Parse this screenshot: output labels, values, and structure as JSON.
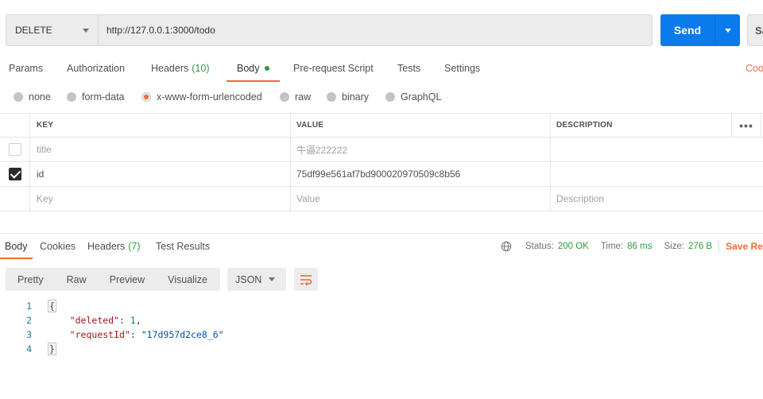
{
  "request": {
    "method": "DELETE",
    "url": "http://127.0.0.1:3000/todo",
    "send_label": "Send",
    "save_label": "Sa"
  },
  "request_tabs": [
    {
      "label": "Params"
    },
    {
      "label": "Authorization"
    },
    {
      "label": "Headers",
      "count": "(10)"
    },
    {
      "label": "Body",
      "active": true
    },
    {
      "label": "Pre-request Script"
    },
    {
      "label": "Tests"
    },
    {
      "label": "Settings"
    }
  ],
  "cookies_link": "Coo",
  "body_types": [
    {
      "label": "none"
    },
    {
      "label": "form-data"
    },
    {
      "label": "x-www-form-urlencoded",
      "selected": true
    },
    {
      "label": "raw"
    },
    {
      "label": "binary"
    },
    {
      "label": "GraphQL"
    }
  ],
  "params_table": {
    "headers": {
      "key": "KEY",
      "value": "VALUE",
      "description": "DESCRIPTION",
      "more": "•••"
    },
    "rows": [
      {
        "checked": false,
        "key": "title",
        "value": "牛逼222222",
        "description": ""
      },
      {
        "checked": true,
        "key": "id",
        "value": "75df99e561af7bd900020970509c8b56",
        "description": ""
      }
    ],
    "placeholder": {
      "key": "Key",
      "value": "Value",
      "description": "Description"
    }
  },
  "response_tabs": [
    {
      "label": "Body",
      "active": true
    },
    {
      "label": "Cookies"
    },
    {
      "label": "Headers",
      "count": "(7)"
    },
    {
      "label": "Test Results"
    }
  ],
  "response_status": {
    "status_label": "Status:",
    "status_value": "200 OK",
    "time_label": "Time:",
    "time_value": "86 ms",
    "size_label": "Size:",
    "size_value": "276 B",
    "save_label": "Save Re"
  },
  "view_modes": [
    "Pretty",
    "Raw",
    "Preview",
    "Visualize"
  ],
  "format": "JSON",
  "response_body": {
    "line_numbers": [
      "1",
      "2",
      "3",
      "4"
    ],
    "open_brace": "{",
    "close_brace": "}",
    "key1": "\"deleted\"",
    "val1": "1",
    "key2": "\"requestId\"",
    "val2": "\"17d957d2ce8_6\""
  },
  "colors": {
    "accent": "#f26b3a",
    "send": "#097bed",
    "success": "#2e9c3f"
  }
}
